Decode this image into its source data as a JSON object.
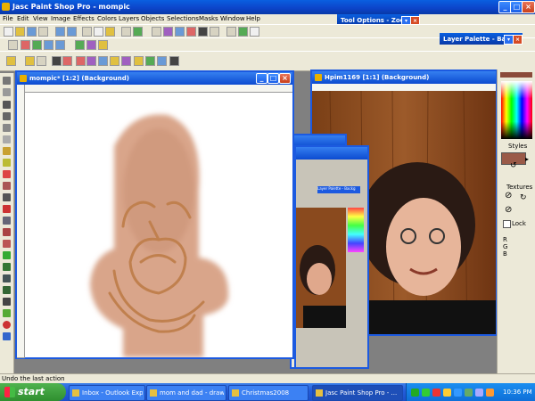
{
  "app": {
    "title": "Jasc Paint Shop Pro - mompic"
  },
  "menu": [
    "File",
    "Edit",
    "View",
    "Image",
    "Effects",
    "Colors",
    "Layers",
    "Objects",
    "Selections",
    "Masks",
    "Window",
    "Help"
  ],
  "tool_options": {
    "title": "Tool Options - Zoom"
  },
  "layer_palette": {
    "title": "Layer Palette - Backg"
  },
  "doc_mompic": {
    "title": "mompic* [1:2] (Background)"
  },
  "doc_photo": {
    "title": "Hpim1169 [1:1] (Background)"
  },
  "nested": {
    "layer_label": "Layer Palette - Backg"
  },
  "right_panel": {
    "styles": "Styles",
    "textures": "Textures",
    "lock": "Lock",
    "r": "R",
    "g": "G",
    "b": "B"
  },
  "status": {
    "text": "Undo the last action"
  },
  "taskbar": {
    "start": "start",
    "items": [
      "Inbox - Outlook Express",
      "mom and dad - drawi...",
      "Christmas2008",
      "Jasc Paint Shop Pro - ..."
    ],
    "clock": "10:36 PM"
  },
  "colors": {
    "accent": "#0c4ad0",
    "skin": "#d9a58a",
    "wood": "#8a4a1e"
  }
}
